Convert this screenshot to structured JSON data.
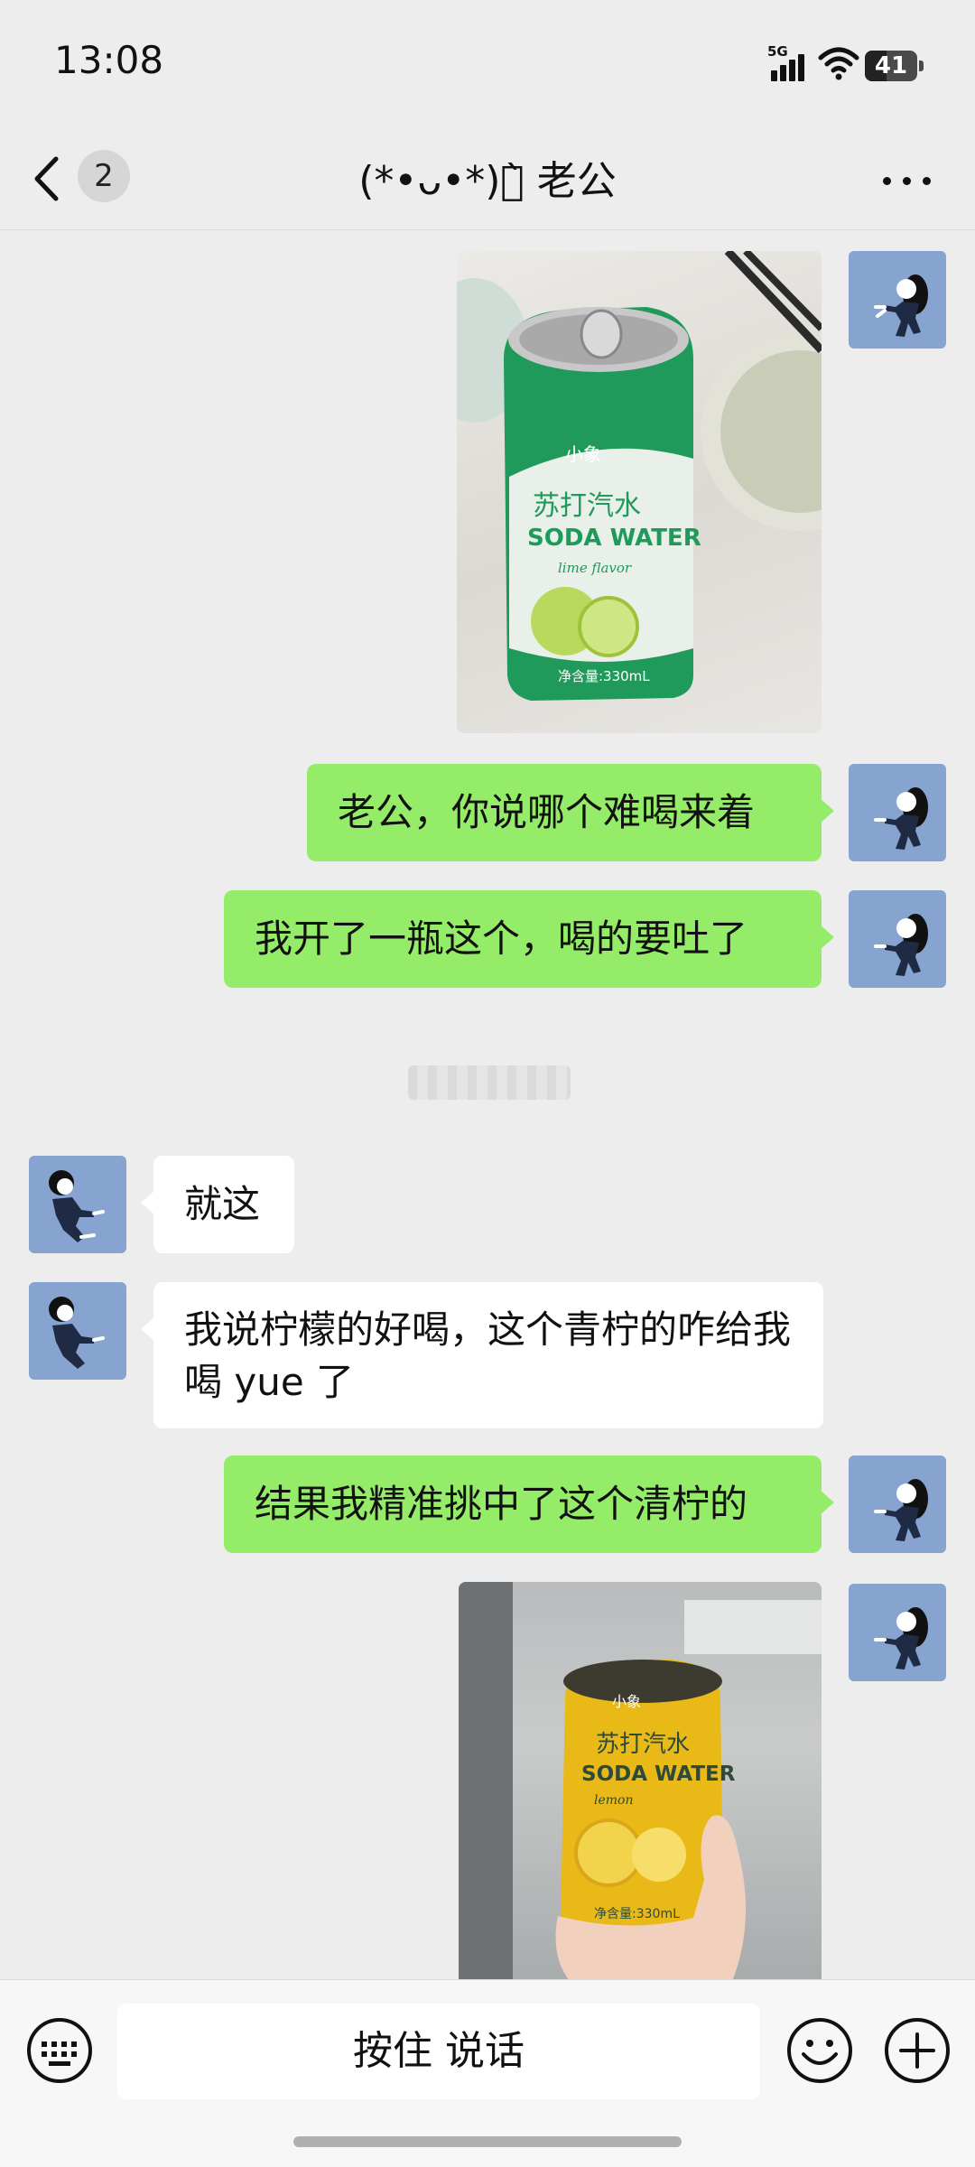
{
  "status_bar": {
    "time": "13:08",
    "network": "5G",
    "battery": "41",
    "battery_level": 0.41
  },
  "nav": {
    "unread_count": "2",
    "title": "(*•ᴗ•*)ง̀ 老公",
    "icons": {
      "back": "chevron-left-icon",
      "more": "more-dots-icon"
    }
  },
  "messages": [
    {
      "side": "right",
      "type": "image",
      "content": "green soda water can (苏打汽水 SODA WATER, lime flavor, 330mL)"
    },
    {
      "side": "right",
      "type": "text",
      "text": "老公，你说哪个难喝来着"
    },
    {
      "side": "right",
      "type": "text",
      "text": "我开了一瓶这个，喝的要吐了"
    },
    {
      "side": "left",
      "type": "text",
      "text": "就这"
    },
    {
      "side": "left",
      "type": "text",
      "text": "我说柠檬的好喝，这个青柠的咋给我喝 yue 了"
    },
    {
      "side": "right",
      "type": "text",
      "text": "结果我精准挑中了这个清柠的"
    },
    {
      "side": "right",
      "type": "image",
      "content": "hand holding yellow soda water can (苏打汽水 SODA WATER, lemon flavor, 330mL)"
    }
  ],
  "can_labels": {
    "brand": "小象",
    "cn_name": "苏打汽水",
    "en_name": "SODA WATER",
    "flavor_lime": "lime flavor",
    "flavor_lemon": "lemon",
    "volume": "净含量:330mL"
  },
  "input_bar": {
    "hold_to_talk": "按住 说话",
    "icons": {
      "keyboard": "keyboard-icon",
      "emoji": "emoji-icon",
      "plus": "plus-icon"
    }
  },
  "colors": {
    "background": "#ededed",
    "outgoing_bubble": "#95ec69",
    "incoming_bubble": "#ffffff",
    "avatar_bg": "#86a4cf"
  }
}
